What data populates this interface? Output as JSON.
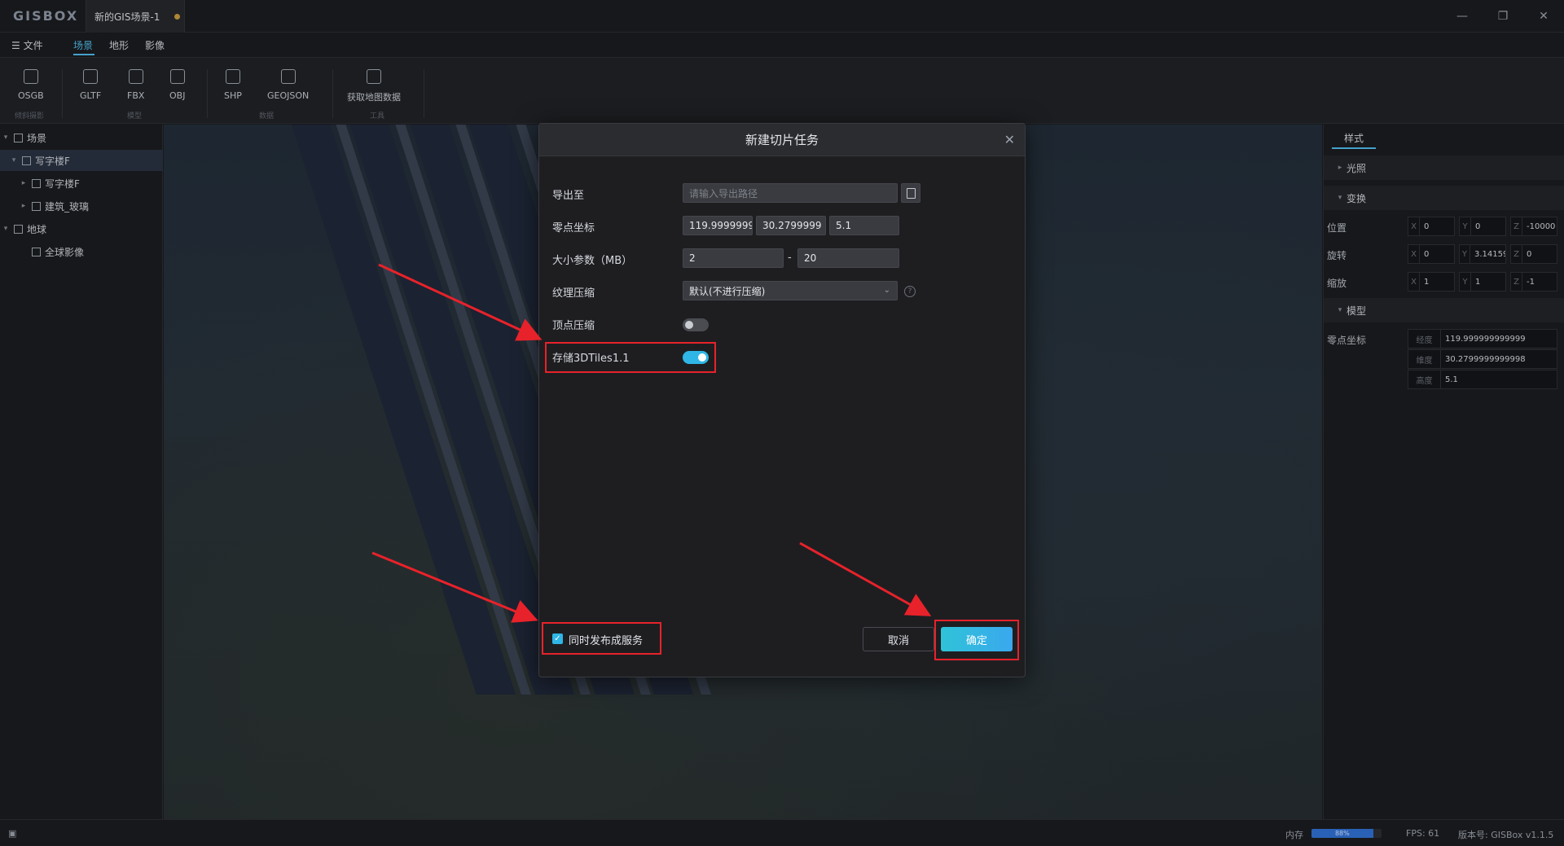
{
  "app": {
    "logo": "GISBOX",
    "doc_tab": "新的GIS场景-1"
  },
  "window_controls": {
    "minimize": "—",
    "restore": "❐",
    "close": "✕"
  },
  "menu": {
    "file": "☰ 文件",
    "items": [
      "场景",
      "地形",
      "影像"
    ]
  },
  "ribbon": {
    "buttons": [
      "OSGB",
      "GLTF",
      "FBX",
      "OBJ",
      "SHP",
      "GEOJSON",
      "获取地图数据"
    ],
    "groups": [
      "倾斜摄影",
      "模型",
      "数据",
      "工具"
    ]
  },
  "tree": [
    {
      "label": "场景",
      "caret": "▾"
    },
    {
      "label": "写字楼F",
      "caret": "▾"
    },
    {
      "label": "写字楼F",
      "caret": "▸"
    },
    {
      "label": "建筑_玻璃",
      "caret": "▸"
    },
    {
      "label": "地球",
      "caret": "▾"
    },
    {
      "label": "全球影像",
      "caret": ""
    }
  ],
  "right_panel": {
    "tab": "样式",
    "sections": {
      "light": "光照",
      "transform": "变换",
      "model": "模型"
    },
    "transform": {
      "position": {
        "label": "位置",
        "x": "0",
        "y": "0",
        "z": "-10000"
      },
      "rotation": {
        "label": "旋转",
        "x": "0",
        "y": "3.14159",
        "z": "0"
      },
      "scale": {
        "label": "缩放",
        "x": "1",
        "y": "1",
        "z": "-1"
      }
    },
    "model": {
      "label": "零点坐标",
      "lon_label": "经度",
      "lon": "119.999999999999",
      "lat_label": "维度",
      "lat": "30.2799999999998",
      "alt_label": "高度",
      "alt": "5.1"
    }
  },
  "dialog": {
    "title": "新建切片任务",
    "export_label": "导出至",
    "export_placeholder": "请输入导出路径",
    "origin_label": "零点坐标",
    "origin_x": "119.9999999",
    "origin_y": "30.2799999",
    "origin_z": "5.1",
    "size_label": "大小参数（MB）",
    "size_min": "2",
    "size_dash": "-",
    "size_max": "20",
    "texture_label": "纹理压缩",
    "texture_value": "默认(不进行压缩)",
    "vertex_label": "顶点压缩",
    "vertex_on": false,
    "tiles_label": "存储3DTiles1.1",
    "tiles_on": true,
    "publish_label": "同时发布成服务",
    "publish_checked": true,
    "cancel": "取消",
    "ok": "确定"
  },
  "status": {
    "memory_label": "内存",
    "memory_percent": "88%",
    "memory_fraction": 0.88,
    "fps": "FPS: 61",
    "version": "版本号: GISBox v1.1.5"
  },
  "annotation_color": "#e8222a",
  "accent": "#2fb6e6"
}
